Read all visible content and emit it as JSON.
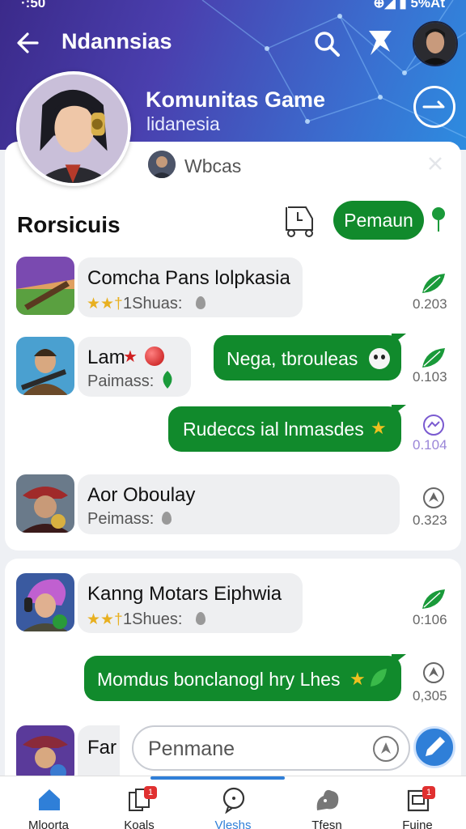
{
  "status_bar": {
    "time": "·:50",
    "right": "⊕◢ ▮ 5%At"
  },
  "header": {
    "title": "Ndannsias",
    "group_name": "Komunitas Game",
    "group_subtitle": "lidanesia"
  },
  "profile": {
    "member_name": "Wbcas"
  },
  "section": {
    "title": "Rorsicuis",
    "pill_label": "Pemaun"
  },
  "messages": [
    {
      "title": "Comcha Pans lolpkasia",
      "sub": "1Shuas:",
      "time": "0.203"
    },
    {
      "title": "Lam",
      "sub": "Paimass:",
      "reply": "Nega, tbrouleas",
      "time": "0.103"
    },
    {
      "reply": "Rudeccs ial lnmasdes",
      "time": "0.104"
    },
    {
      "title": "Aor Oboulay",
      "sub": "Peimass:",
      "time": "0.323"
    },
    {
      "title": "Kanng Motars Eiphwia",
      "sub": "1Shues:",
      "time": "0:106"
    },
    {
      "reply": "Momdus bonclanogl hry Lhes",
      "time": "0,305"
    },
    {
      "title": "Far"
    }
  ],
  "composer": {
    "placeholder": "Penmane"
  },
  "bottom_nav": [
    {
      "label": "Mloorta",
      "icon": "home-icon",
      "badge": ""
    },
    {
      "label": "Koals",
      "icon": "cards-icon",
      "badge": "1"
    },
    {
      "label": "Vleshs",
      "icon": "chat-icon",
      "badge": ""
    },
    {
      "label": "Tfesn",
      "icon": "puzzle-icon",
      "badge": ""
    },
    {
      "label": "Fuine",
      "icon": "inbox-icon",
      "badge": "1"
    }
  ],
  "colors": {
    "accent_green": "#118a2c",
    "header_start": "#3b2a8a",
    "header_end": "#2d8ce0",
    "nav_active": "#2f7fd8"
  }
}
